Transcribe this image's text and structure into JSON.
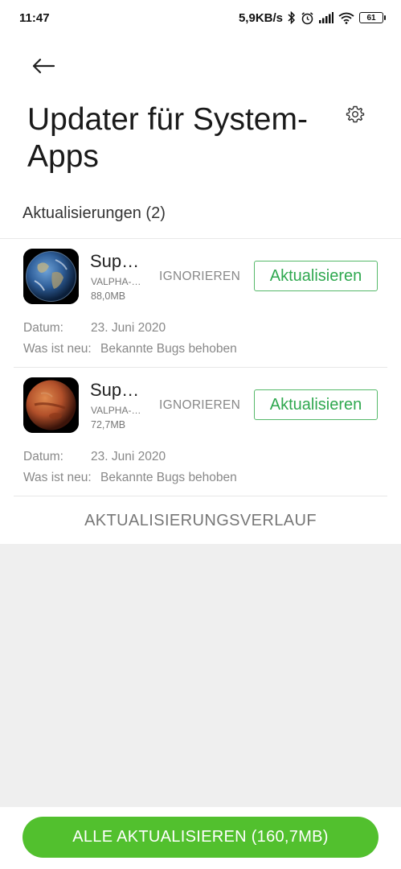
{
  "status": {
    "time": "11:47",
    "net_speed": "5,9KB/s",
    "battery": "61"
  },
  "header": {
    "title": "Updater für System-Apps"
  },
  "updates": {
    "heading": "Aktualisierungen (2)",
    "items": [
      {
        "name": "Supe…",
        "version": "VALPHA-…",
        "size": "88,0MB",
        "ignore_label": "IGNORIEREN",
        "update_label": "Aktualisieren",
        "date_label": "Datum:",
        "date_value": "23. Juni 2020",
        "whatsnew_label": "Was ist neu:",
        "whatsnew_value": "Bekannte Bugs behoben",
        "icon": "earth-icon"
      },
      {
        "name": "Supe…",
        "version": "VALPHA-…",
        "size": "72,7MB",
        "ignore_label": "IGNORIEREN",
        "update_label": "Aktualisieren",
        "date_label": "Datum:",
        "date_value": "23. Juni 2020",
        "whatsnew_label": "Was ist neu:",
        "whatsnew_value": "Bekannte Bugs behoben",
        "icon": "mars-icon"
      }
    ],
    "history_label": "AKTUALISIERUNGSVERLAUF"
  },
  "footer": {
    "update_all_label": "ALLE AKTUALISIEREN (160,7MB)"
  },
  "colors": {
    "accent_green": "#2fa84f",
    "button_green": "#52c02e",
    "background_gray": "#efefef"
  }
}
